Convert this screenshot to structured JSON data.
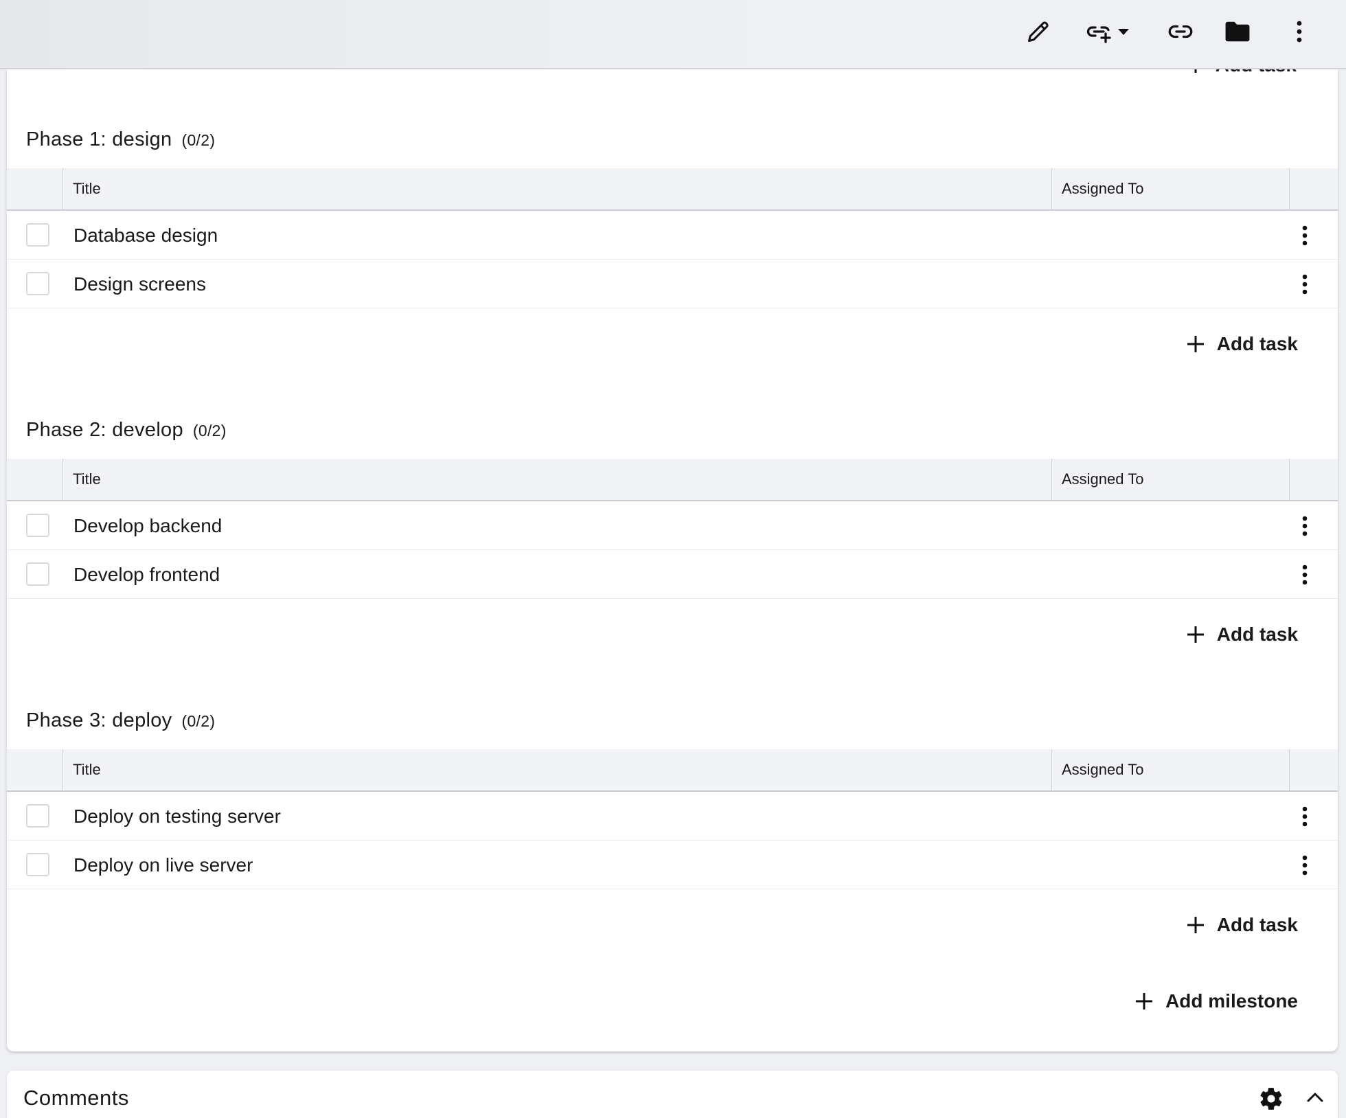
{
  "toolbar": {
    "icons": [
      "pencil-icon",
      "link-add-icon",
      "caret-down-icon",
      "link-icon",
      "folder-icon",
      "more-vertical-icon"
    ]
  },
  "partial_add_label": "Add task",
  "table_headers": {
    "title": "Title",
    "assigned_to": "Assigned To"
  },
  "phases": [
    {
      "title": "Phase 1: design",
      "count": "(0/2)",
      "tasks": [
        {
          "title": "Database design",
          "assigned_to": ""
        },
        {
          "title": "Design screens",
          "assigned_to": ""
        }
      ],
      "add_label": "Add task"
    },
    {
      "title": "Phase 2: develop",
      "count": "(0/2)",
      "tasks": [
        {
          "title": "Develop backend",
          "assigned_to": ""
        },
        {
          "title": "Develop frontend",
          "assigned_to": ""
        }
      ],
      "add_label": "Add task"
    },
    {
      "title": "Phase 3: deploy",
      "count": "(0/2)",
      "tasks": [
        {
          "title": "Deploy on testing server",
          "assigned_to": ""
        },
        {
          "title": "Deploy on live server",
          "assigned_to": ""
        }
      ],
      "add_label": "Add task"
    }
  ],
  "add_milestone_label": "Add milestone",
  "comments": {
    "title": "Comments",
    "icons": [
      "gear-icon",
      "chevron-up-icon"
    ]
  }
}
